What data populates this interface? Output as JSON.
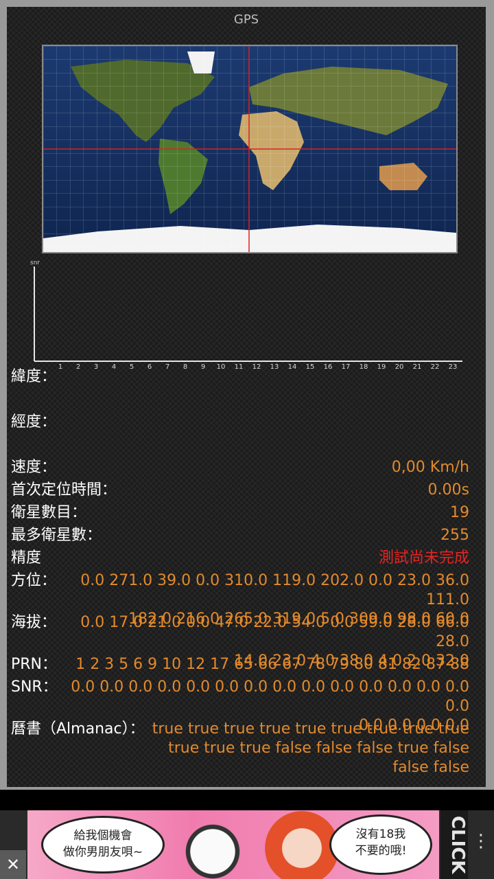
{
  "title": "GPS",
  "chart": {
    "ylabel": "snr",
    "ticks": [
      "1",
      "2",
      "3",
      "4",
      "5",
      "6",
      "7",
      "8",
      "9",
      "10",
      "11",
      "12",
      "13",
      "14",
      "15",
      "16",
      "17",
      "18",
      "19",
      "20",
      "21",
      "22",
      "23"
    ]
  },
  "fields": {
    "latitude": {
      "label": "緯度：",
      "value": ""
    },
    "longitude": {
      "label": "經度：",
      "value": ""
    },
    "speed": {
      "label": "速度：",
      "value": "0,00 Km/h"
    },
    "ttff": {
      "label": "首次定位時間：",
      "value": "0.00s"
    },
    "sat_count": {
      "label": "衛星數目：",
      "value": "19"
    },
    "max_sats": {
      "label": "最多衛星數：",
      "value": "255"
    },
    "accuracy": {
      "label": "精度",
      "value": "測試尚未完成"
    },
    "azimuth": {
      "label": "方位：",
      "lines": [
        "0.0 271.0 39.0 0.0 310.0 119.0 202.0 0.0 23.0 36.0 111.0",
        "182.0 216.0 265.0 319.0 5.0 309.0 98.0 60.0"
      ]
    },
    "elevation": {
      "label": "海拔：",
      "lines": [
        "0.0 17.0 21.0 0.0 47.0 22.0 54.0 0.0 59.0 28.0 66.0 28.0",
        "14.0 23.0 4.0 38.0 4.0 2.0 32.0"
      ]
    },
    "prn": {
      "label": "PRN：",
      "value": "1 2 3 5 6 9 10 12 17 65 66 67 78 79 80 81 82 87 88"
    },
    "snr": {
      "label": "SNR：",
      "lines": [
        "0.0 0.0 0.0 0.0 0.0 0.0 0.0 0.0 0.0 0.0 0.0 0.0 0.0 0.0 0.0",
        "0.0 0.0 0.0 0.0"
      ]
    },
    "almanac": {
      "label": "曆書（Almanac）：",
      "lines": [
        "true true true true true true true true true",
        "true true true false false false true false",
        "false false"
      ]
    }
  },
  "ad": {
    "left_bubble": "給我個機會\n做你男朋友唄~",
    "right_bubble": "沒有18我\n不要的哦!",
    "side_text": "CLICK",
    "close": "✕",
    "menu": "⋮"
  }
}
